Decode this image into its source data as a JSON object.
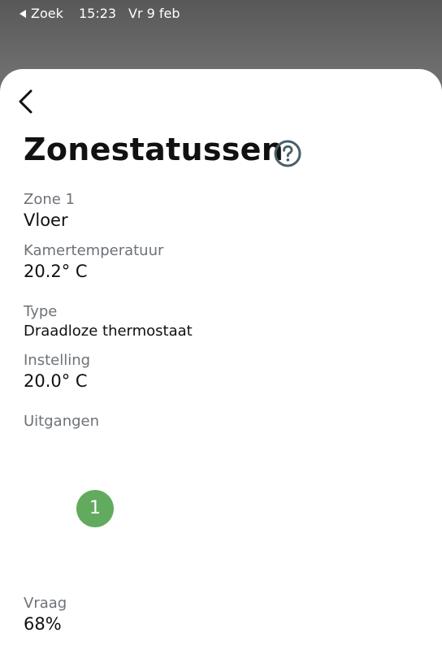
{
  "status_bar": {
    "back_label": "Zoek",
    "time": "15:23",
    "date": "Vr 9 feb"
  },
  "header": {
    "title": "Zonestatussen"
  },
  "details": {
    "zone_label": "Zone 1",
    "zone_value": "Vloer",
    "room_temp_label": "Kamertemperatuur",
    "room_temp_value": "20.2° C",
    "type_label": "Type",
    "type_value": "Draadloze thermostaat",
    "setting_label": "Instelling",
    "setting_value": "20.0° C",
    "outputs_label": "Uitgangen",
    "outputs": [
      "1"
    ],
    "demand_label": "Vraag",
    "demand_value": "68%"
  },
  "icons": {
    "back": "chevron-left-icon",
    "help": "question-circle-icon",
    "status_back": "triangle-left-icon"
  },
  "colors": {
    "output_badge": "#62ab5e",
    "help_icon": "#4a5f68",
    "label": "#6d7278"
  }
}
